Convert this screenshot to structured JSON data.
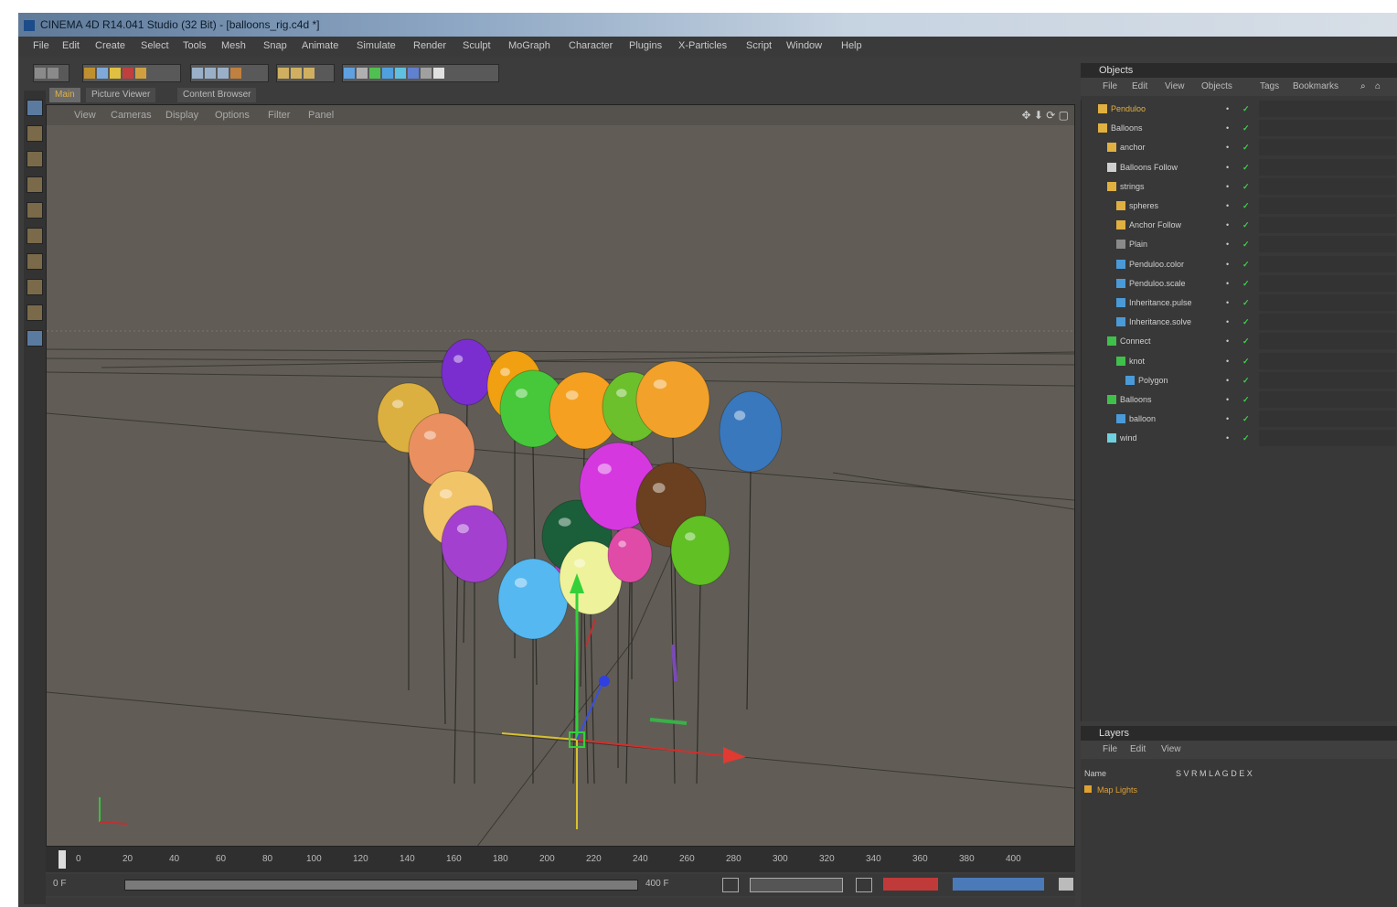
{
  "window": {
    "title": "CINEMA 4D R14.041 Studio (32 Bit) - [balloons_rig.c4d *]"
  },
  "menu": [
    "File",
    "Edit",
    "Create",
    "Select",
    "Tools",
    "Mesh",
    "Snap",
    "Animate",
    "Simulate",
    "Render",
    "Sculpt",
    "MoGraph",
    "Character",
    "Plugins",
    "X-Particles",
    "Script",
    "Window",
    "Help"
  ],
  "viewport": {
    "tabs": [
      "Main",
      "Picture Viewer",
      "Content Browser"
    ],
    "menu": [
      "View",
      "Cameras",
      "Display",
      "Options",
      "Filter",
      "Panel"
    ],
    "controls": "✥ ⬇ ⟳ ▢"
  },
  "objects": {
    "title": "Objects",
    "menu": [
      "File",
      "Edit",
      "View",
      "Objects",
      "Tags",
      "Bookmarks"
    ],
    "items": [
      {
        "name": "Penduloo",
        "color": "#e0b040",
        "level": 0,
        "icon": "null-icon"
      },
      {
        "name": "Balloons",
        "color": "#cfcfcf",
        "level": 0,
        "icon": "null-icon"
      },
      {
        "name": "anchor",
        "color": "#cfcfcf",
        "level": 1,
        "icon": "null-icon"
      },
      {
        "name": "Balloons Follow",
        "color": "#cfcfcf",
        "level": 1,
        "icon": "light-icon"
      },
      {
        "name": "strings",
        "color": "#cfcfcf",
        "level": 1,
        "icon": "null-icon"
      },
      {
        "name": "spheres",
        "color": "#cfcfcf",
        "level": 2,
        "icon": "null-icon"
      },
      {
        "name": "Anchor Follow",
        "color": "#cfcfcf",
        "level": 2,
        "icon": "null-icon"
      },
      {
        "name": "Plain",
        "color": "#cfcfcf",
        "level": 2,
        "icon": "spline-icon"
      },
      {
        "name": "Penduloo.color",
        "color": "#cfcfcf",
        "level": 2,
        "icon": "cloner-icon"
      },
      {
        "name": "Penduloo.scale",
        "color": "#cfcfcf",
        "level": 2,
        "icon": "cloner-icon"
      },
      {
        "name": "Inheritance.pulse",
        "color": "#cfcfcf",
        "level": 2,
        "icon": "effector-icon"
      },
      {
        "name": "Inheritance.solve",
        "color": "#cfcfcf",
        "level": 2,
        "icon": "effector-icon"
      },
      {
        "name": "Connect",
        "color": "#cfcfcf",
        "level": 1,
        "icon": "connect-icon"
      },
      {
        "name": "knot",
        "color": "#cfcfcf",
        "level": 2,
        "icon": "sphere-icon"
      },
      {
        "name": "Polygon",
        "color": "#cfcfcf",
        "level": 3,
        "icon": "polygon-icon"
      },
      {
        "name": "Balloons",
        "color": "#cfcfcf",
        "level": 1,
        "icon": "sphere-icon"
      },
      {
        "name": "balloon",
        "color": "#cfcfcf",
        "level": 2,
        "icon": "polygon-icon"
      },
      {
        "name": "wind",
        "color": "#cfcfcf",
        "level": 1,
        "icon": "deformer-icon"
      }
    ]
  },
  "layers": {
    "title": "Layers",
    "menu": [
      "File",
      "Edit",
      "View"
    ],
    "header": "Name",
    "flags": "S V R M L A G D E X",
    "rows": [
      {
        "name": "Map Lights",
        "color": "#e0a030"
      }
    ]
  },
  "timeline": {
    "ticks": [
      "0",
      "20",
      "40",
      "60",
      "80",
      "100",
      "120",
      "140",
      "160",
      "180",
      "200",
      "220",
      "240",
      "260",
      "280",
      "300",
      "320",
      "340",
      "360",
      "380",
      "400"
    ],
    "start_field": "0 F",
    "end_field": "400 F"
  },
  "balloon_colors": [
    "#7a2ed0",
    "#f0a010",
    "#46c83a",
    "#f5a020",
    "#6cc02c",
    "#f2a22a",
    "#3a78bd",
    "#dcb040",
    "#ea9060",
    "#f2c468",
    "#a440d0",
    "#b23cc8",
    "#1b5e3a",
    "#d638e0",
    "#6a4020",
    "#60c024",
    "#55b8f0",
    "#eef29a",
    "#e04ba8"
  ]
}
